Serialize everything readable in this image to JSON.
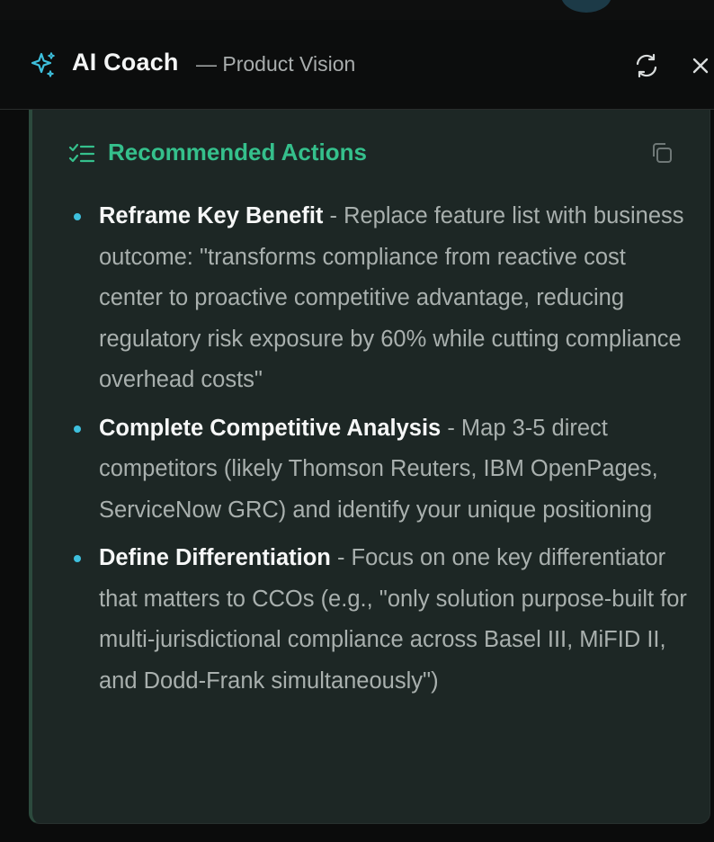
{
  "header": {
    "title": "AI Coach",
    "subtitle": "— Product Vision",
    "icons": {
      "logo": "sparkle-icon",
      "refresh": "refresh-icon",
      "close": "close-icon"
    },
    "colors": {
      "accent": "#3ec0dd",
      "title": "#f4f5f5"
    }
  },
  "card": {
    "title": "Recommended Actions",
    "icons": {
      "heading": "checklist-icon",
      "copy": "copy-icon"
    },
    "colors": {
      "heading": "#35c08c",
      "bullet": "#3ec0dd",
      "background": "#1d2725"
    },
    "items": [
      {
        "title": "Reframe Key Benefit",
        "body": " - Replace feature list with business outcome: \"transforms compliance from reactive cost center to proactive competitive advantage, reducing regulatory risk exposure by 60% while cutting compliance overhead costs\""
      },
      {
        "title": "Complete Competitive Analysis",
        "body": " - Map 3-5 direct competitors (likely Thomson Reuters, IBM OpenPages, ServiceNow GRC) and identify your unique positioning"
      },
      {
        "title": "Define Differentiation",
        "body": " - Focus on one key differentiator that matters to CCOs (e.g., \"only solution purpose-built for multi-jurisdictional compliance across Basel III, MiFID II, and Dodd-Frank simultaneously\")"
      }
    ]
  }
}
